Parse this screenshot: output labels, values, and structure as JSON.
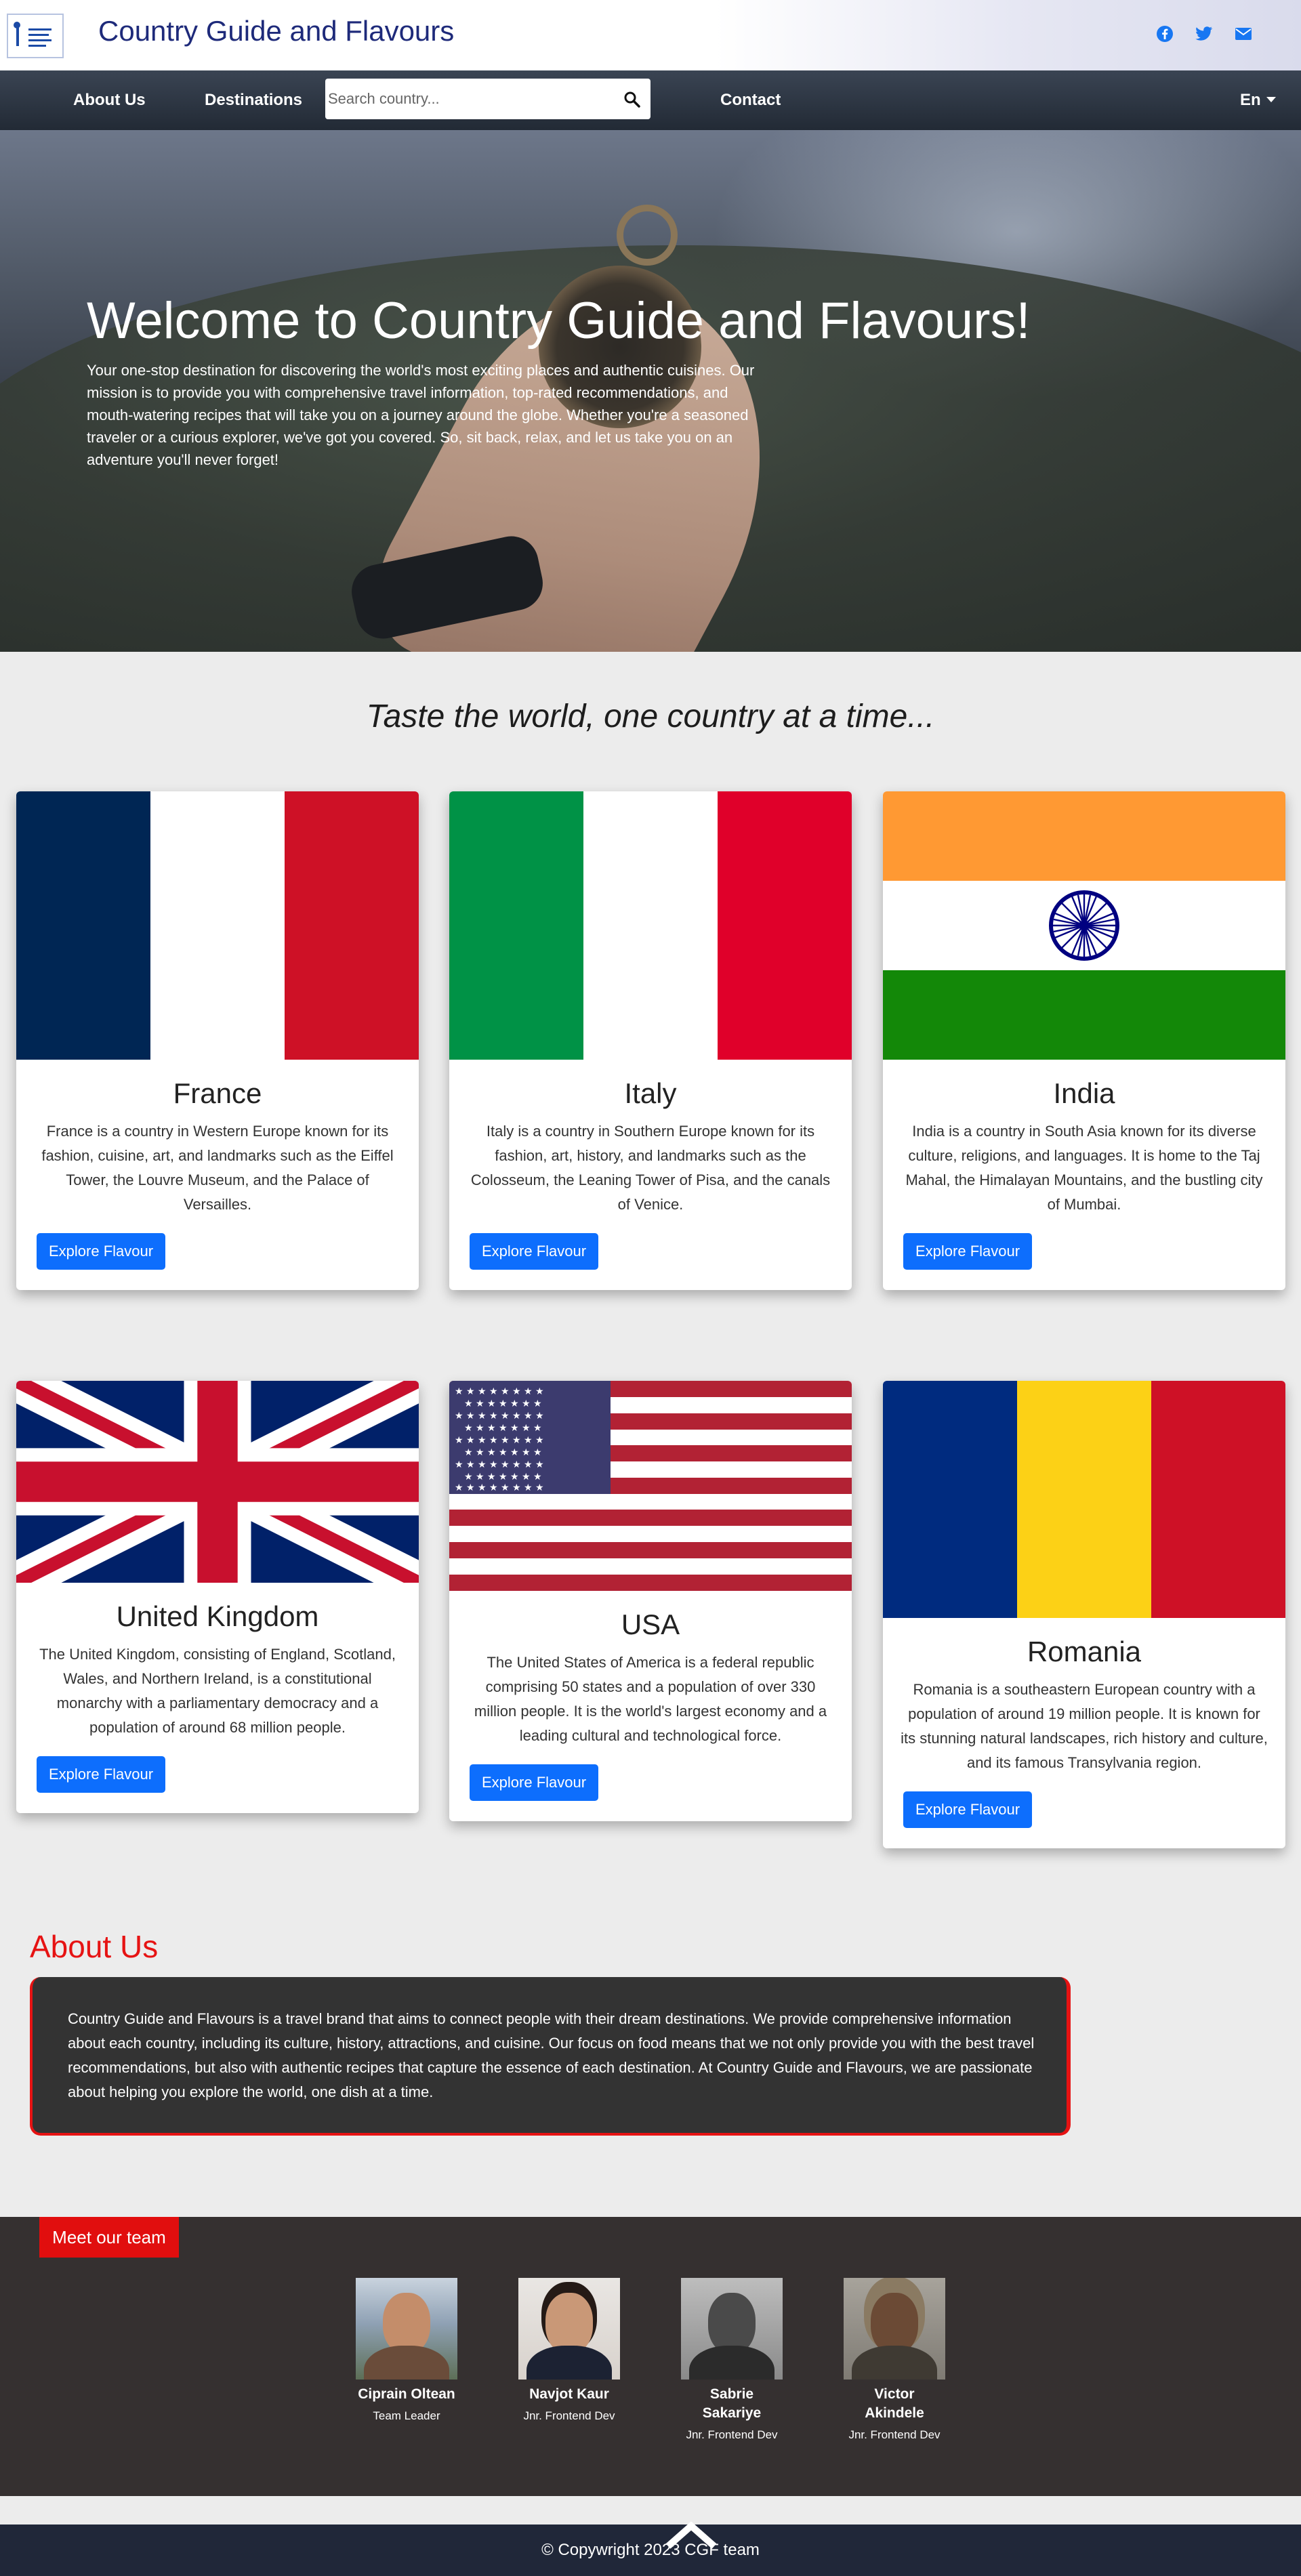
{
  "header": {
    "brand": "Country Guide and Flavours",
    "logo_icon": "cgf-logo-icon",
    "social": [
      {
        "name": "facebook-icon"
      },
      {
        "name": "twitter-icon"
      },
      {
        "name": "envelope-icon"
      }
    ],
    "accent": "#1877f2"
  },
  "nav": {
    "about": "About Us",
    "destinations": "Destinations",
    "search_placeholder": "Search country...",
    "contact": "Contact",
    "lang": "En"
  },
  "hero": {
    "title": "Welcome to Country Guide and Flavours!",
    "text": "Your one-stop destination for discovering the world's most exciting places and authentic cuisines. Our mission is to provide you with comprehensive travel information, top-rated recommendations, and mouth-watering recipes that will take you on a journey around the globe. Whether you're a seasoned traveler or a curious explorer, we've got you covered. So, sit back, relax, and let us take you on an adventure you'll never forget!"
  },
  "tagline": "Taste the world, one country at a time...",
  "cards": [
    {
      "title": "France",
      "text": "France is a country in Western Europe known for its fashion, cuisine, art, and landmarks such as the Eiffel Tower, the Louvre Museum, and the Palace of Versailles.",
      "button": "Explore Flavour"
    },
    {
      "title": "Italy",
      "text": "Italy is a country in Southern Europe known for its fashion, art, history, and landmarks such as the Colosseum, the Leaning Tower of Pisa, and the canals of Venice.",
      "button": "Explore Flavour"
    },
    {
      "title": "India",
      "text": "India is a country in South Asia known for its diverse culture, religions, and languages. It is home to the Taj Mahal, the Himalayan Mountains, and the bustling city of Mumbai.",
      "button": "Explore Flavour"
    },
    {
      "title": "United Kingdom",
      "text": "The United Kingdom, consisting of England, Scotland, Wales, and Northern Ireland, is a constitutional monarchy with a parliamentary democracy and a population of around 68 million people.",
      "button": "Explore Flavour"
    },
    {
      "title": "USA",
      "text": "The United States of America is a federal republic comprising 50 states and a population of over 330 million people. It is the world's largest economy and a leading cultural and technological force.",
      "button": "Explore Flavour"
    },
    {
      "title": "Romania",
      "text": "Romania is a southeastern European country with a population of around 19 million people. It is known for its stunning natural landscapes, rich history and culture, and its famous Transylvania region.",
      "button": "Explore Flavour"
    }
  ],
  "about": {
    "heading": "About Us",
    "text": "Country Guide and Flavours is a travel brand that aims to connect people with their dream destinations. We provide comprehensive information about each country, including its culture, history, attractions, and cuisine. Our focus on food means that we not only provide you with the best travel recommendations, but also with authentic recipes that capture the essence of each destination. At Country Guide and Flavours, we are passionate about helping you explore the world, one dish at a time."
  },
  "team": {
    "badge": "Meet our team",
    "members": [
      {
        "name": "Ciprain Oltean",
        "role": "Team Leader"
      },
      {
        "name": "Navjot Kaur",
        "role": "Jnr. Frontend Dev"
      },
      {
        "name": "Sabrie Sakariye",
        "role": "Jnr. Frontend Dev"
      },
      {
        "name": "Victor Akindele",
        "role": "Jnr. Frontend Dev"
      }
    ]
  },
  "footer": {
    "text": "© Copywright 2023 CGF team",
    "back_to_top_icon": "chevron-up-icon"
  }
}
